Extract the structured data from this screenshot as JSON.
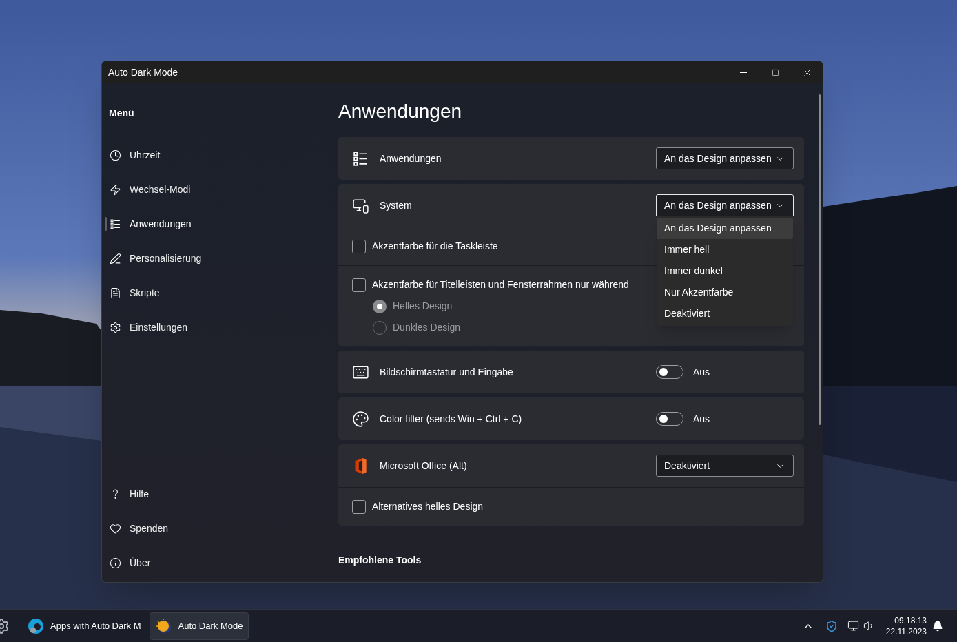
{
  "window": {
    "title": "Auto Dark Mode"
  },
  "sidebar": {
    "heading": "Menü",
    "items": [
      {
        "label": "Uhrzeit",
        "selected": false
      },
      {
        "label": "Wechsel-Modi",
        "selected": false
      },
      {
        "label": "Anwendungen",
        "selected": true
      },
      {
        "label": "Personalisierung",
        "selected": false
      },
      {
        "label": "Skripte",
        "selected": false
      },
      {
        "label": "Einstellungen",
        "selected": false
      }
    ],
    "footer_items": [
      {
        "label": "Hilfe",
        "selected": false
      },
      {
        "label": "Spenden",
        "selected": false
      },
      {
        "label": "Über",
        "selected": false
      }
    ]
  },
  "page": {
    "title": "Anwendungen",
    "cards": [
      {
        "kind": "dropdown",
        "label": "Anwendungen",
        "value": "An das Design anpassen",
        "expanded": false
      },
      {
        "kind": "dropdown",
        "label": "System",
        "value": "An das Design anpassen",
        "expanded": true,
        "options": [
          {
            "label": "An das Design anpassen",
            "selected": true
          },
          {
            "label": "Immer hell",
            "selected": false
          },
          {
            "label": "Immer dunkel",
            "selected": false
          },
          {
            "label": "Nur Akzentfarbe",
            "selected": false
          },
          {
            "label": "Deaktiviert",
            "selected": false
          }
        ],
        "rows": [
          {
            "label": "Akzentfarbe für die Taskleiste",
            "checked": false
          },
          {
            "label": "Akzentfarbe für Titelleisten und Fensterrahmen nur während",
            "checked": false,
            "radios": [
              {
                "label": "Helles Design",
                "selected": true,
                "disabled": true
              },
              {
                "label": "Dunkles Design",
                "selected": false,
                "disabled": true
              }
            ]
          }
        ]
      },
      {
        "kind": "toggle",
        "label": "Bildschirmtastatur und Eingabe",
        "on": false,
        "state_text": "Aus"
      },
      {
        "kind": "toggle",
        "label": "Color filter (sends Win + Ctrl + C)",
        "on": false,
        "state_text": "Aus"
      },
      {
        "kind": "dropdown",
        "label": "Microsoft Office (Alt)",
        "value": "Deaktiviert",
        "expanded": false,
        "rows": [
          {
            "label": "Alternatives helles Design",
            "checked": false
          }
        ]
      }
    ],
    "next_heading": "Empfohlene Tools"
  },
  "taskbar": {
    "apps": [
      {
        "label": "Apps with Auto Dark M",
        "selected": false
      },
      {
        "label": "Auto Dark Mode",
        "selected": true
      }
    ],
    "time": "09:18:13",
    "date": "22.11.2023"
  }
}
